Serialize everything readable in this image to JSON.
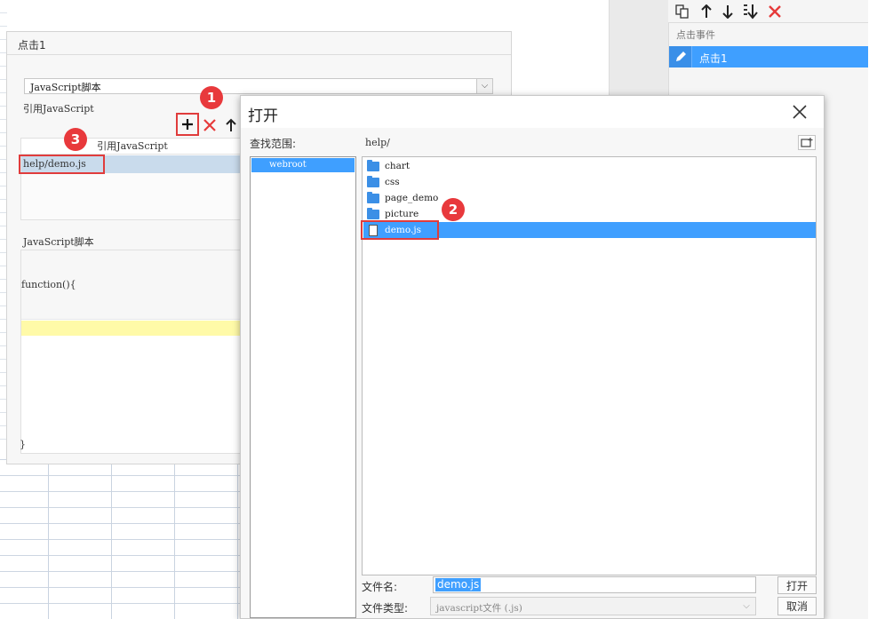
{
  "background": {
    "grid_rows": 10
  },
  "editor": {
    "title": "点击1",
    "action_select": "JavaScript脚本",
    "ref_label": "引用JavaScript",
    "ref_table_header": "引用JavaScript",
    "ref_rows": [
      "help/demo.js"
    ],
    "script_label": "JavaScript脚本",
    "script_open": "function(){",
    "script_close": "}"
  },
  "right_panel": {
    "section_label": "点击事件",
    "events": [
      "点击1"
    ]
  },
  "dialog": {
    "title": "打开",
    "look_in_label": "查找范围:",
    "current_path": "help/",
    "roots": [
      "webroot"
    ],
    "files": [
      {
        "name": "chart",
        "type": "folder",
        "selected": false
      },
      {
        "name": "css",
        "type": "folder",
        "selected": false
      },
      {
        "name": "page_demo",
        "type": "folder",
        "selected": false
      },
      {
        "name": "picture",
        "type": "folder",
        "selected": false
      },
      {
        "name": "demo.js",
        "type": "file",
        "selected": true
      }
    ],
    "filename_label": "文件名:",
    "filename_value": "demo.js",
    "filetype_label": "文件类型:",
    "filetype_value": "javascript文件 (.js)",
    "open_button": "打开",
    "cancel_button": "取消"
  },
  "annotations": {
    "step1": "1",
    "step2": "2",
    "step3": "3"
  },
  "colors": {
    "accent_blue": "#3f9fff",
    "highlight_red": "#e03c3c",
    "badge_red": "#e8393c",
    "yellow_line": "#fffaa8"
  }
}
